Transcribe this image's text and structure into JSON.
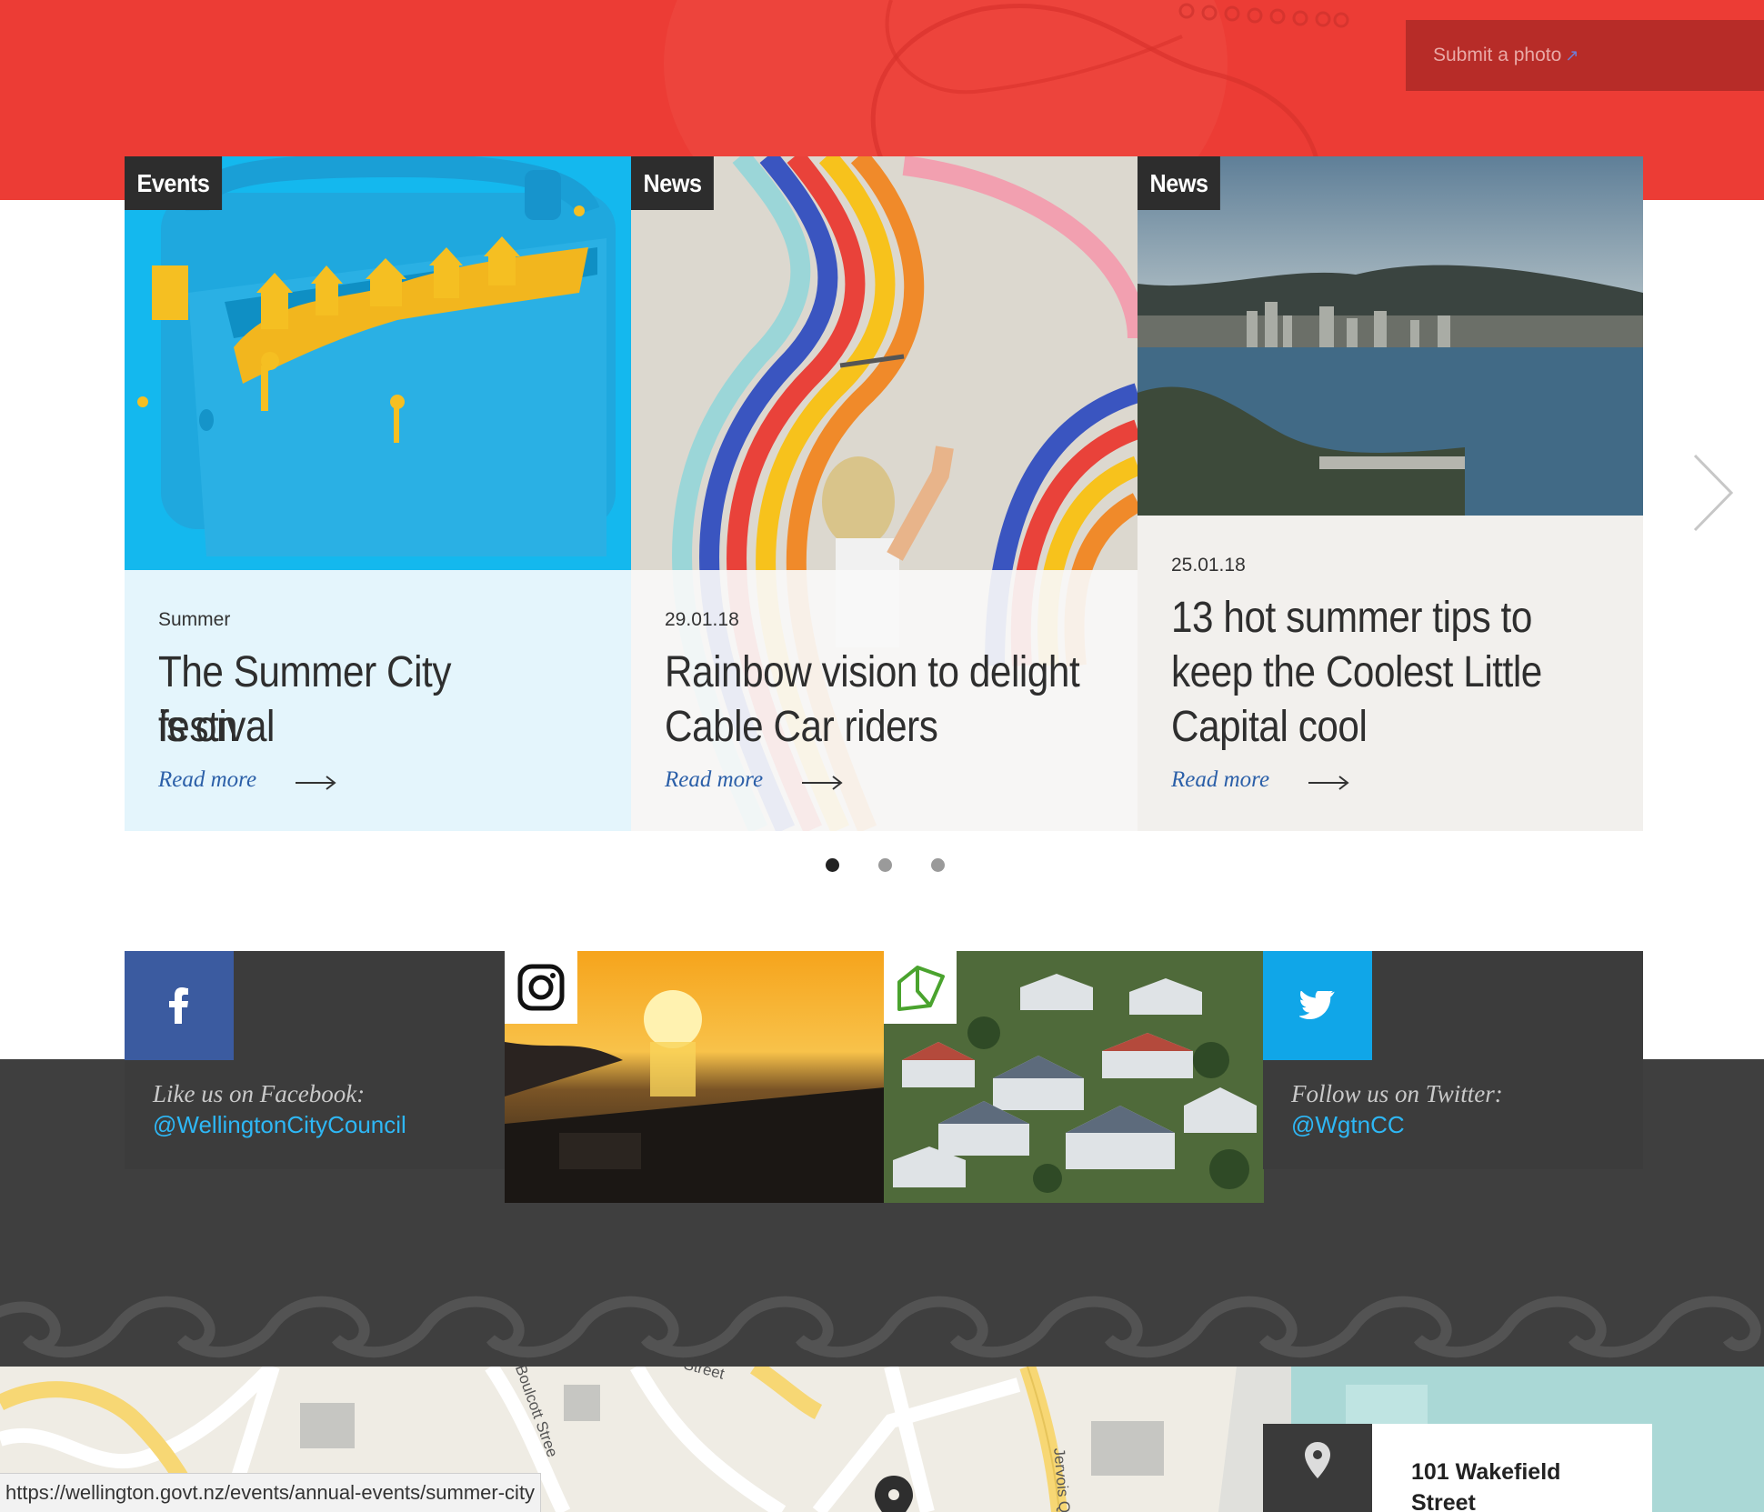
{
  "hero": {
    "submit_label": "Submit a photo",
    "submit_icon": "external-link-icon"
  },
  "cards": [
    {
      "tag": "Events",
      "meta": "Summer",
      "title_lines": [
        "The Summer City festival",
        "is on"
      ],
      "read_more": "Read more",
      "image": "blue chilly bin with yellow town sculpture"
    },
    {
      "tag": "News",
      "meta": "29.01.18",
      "title_lines": [
        "Rainbow vision to delight",
        "Cable Car riders"
      ],
      "read_more": "Read more",
      "image": "woman painting a rainbow mural"
    },
    {
      "tag": "News",
      "meta": "25.01.18",
      "title_lines": [
        "13 hot summer tips to",
        "keep the Coolest Little",
        "Capital cool"
      ],
      "read_more": "Read more",
      "image": "view over Wellington harbour"
    }
  ],
  "carousel": {
    "dot_count": 3,
    "active_dot": 1
  },
  "social": {
    "facebook": {
      "label": "Like us on Facebook:",
      "handle": "@WellingtonCityCouncil"
    },
    "twitter": {
      "label": "Follow us on Twitter:",
      "handle": "@WgtnCC"
    },
    "instagram": {
      "image": "sunset over harbour"
    },
    "homes": {
      "image": "suburban houses hillside"
    }
  },
  "address": {
    "line1": "101 Wakefield",
    "line2": "Street"
  },
  "map": {
    "streets": [
      "Street",
      "Boulcott Street",
      "Jervois Q"
    ]
  },
  "status_bar": {
    "url": "https://wellington.govt.nz/events/annual-events/summer-city"
  },
  "colors": {
    "hero_red": "#ec3c35",
    "dark": "#3f3f3f",
    "facebook": "#3b5ba0",
    "twitter": "#10a6e8",
    "link": "#2b5fa8"
  }
}
